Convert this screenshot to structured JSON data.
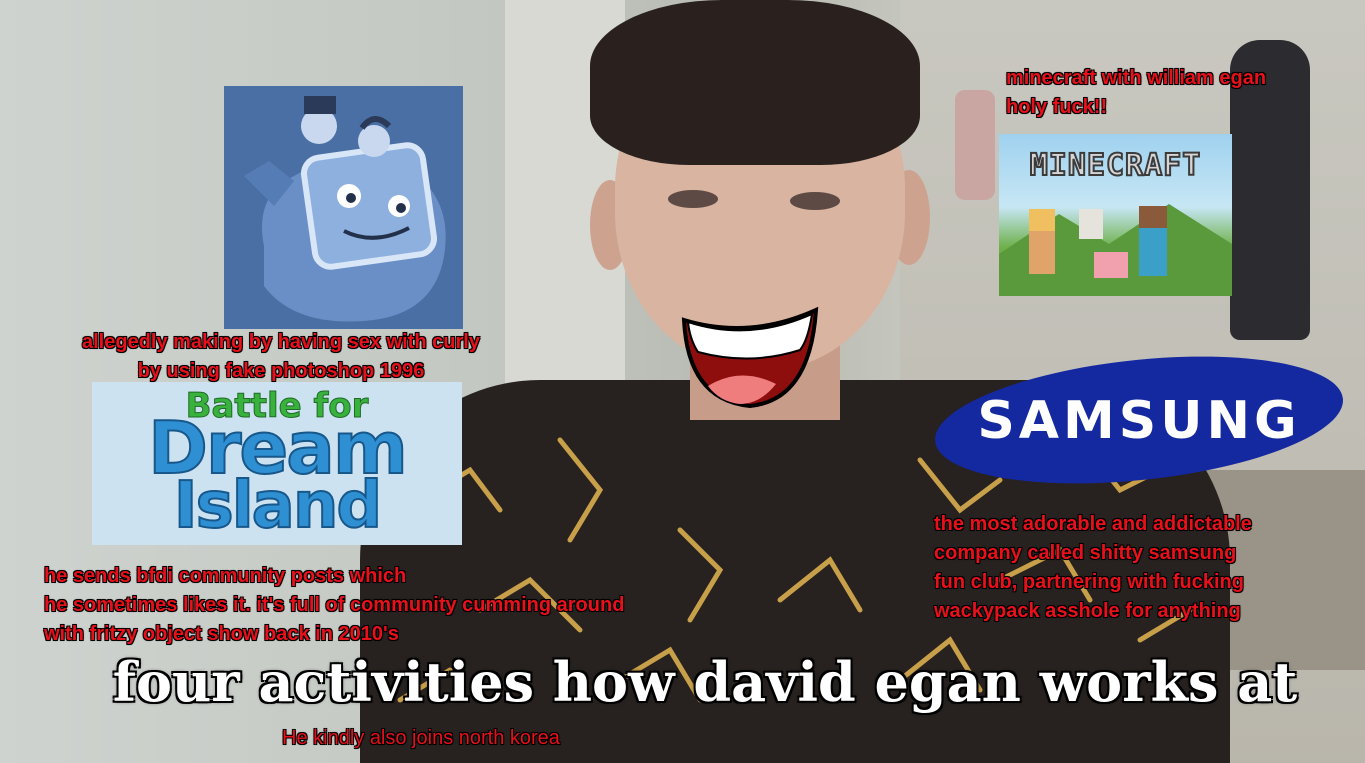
{
  "captions": {
    "minecraft": "minecraft with william egan\nholy fuck!!",
    "curly": "allegedly making by having sex with curly\nby using fake photoshop 1996",
    "bfdi": "he sends bfdi community posts which\nhe sometimes likes it. it's full of community cumming around\nwith fritzy object show back in 2010's",
    "samsung": "the most adorable and addictable\ncompany called shitty samsung\nfun club, partnering with fucking\nwackypack asshole for anything",
    "north_korea": "He kindly also joins north korea"
  },
  "title": "four activities how david egan works at",
  "logos": {
    "bfdi_top": "Battle for",
    "bfdi_mid": "Dream",
    "bfdi_bot": "Island",
    "minecraft": "MINECRAFT",
    "samsung": "SAMSUNG"
  },
  "colors": {
    "caption_red": "#e8101a",
    "samsung_blue": "#1428a0",
    "title_white": "#ffffff"
  }
}
